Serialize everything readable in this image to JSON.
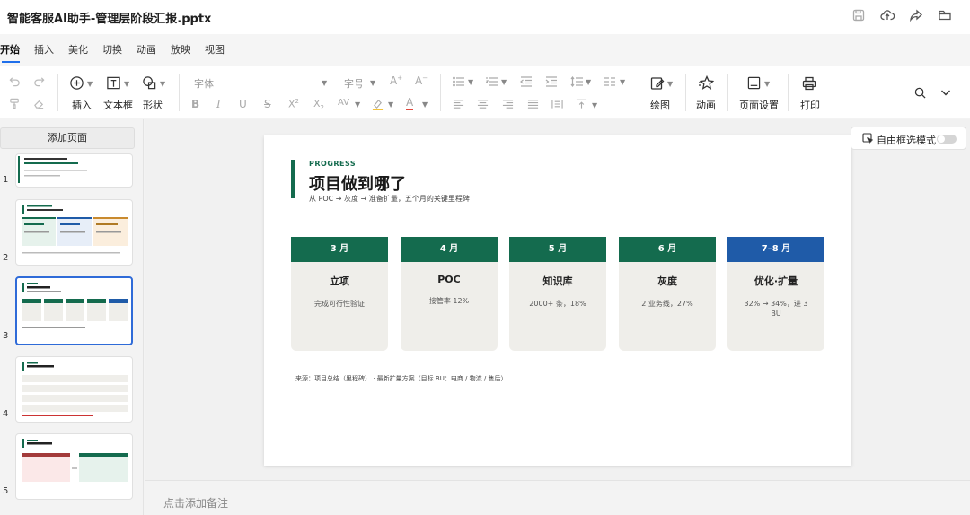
{
  "window": {
    "title": "智能客服AI助手-管理层阶段汇报.pptx"
  },
  "tabs": [
    {
      "label": "开始",
      "active": true
    },
    {
      "label": "插入"
    },
    {
      "label": "美化"
    },
    {
      "label": "切换"
    },
    {
      "label": "动画"
    },
    {
      "label": "放映"
    },
    {
      "label": "视图"
    }
  ],
  "toolbar": {
    "insert_label": "插入",
    "textbox_label": "文本框",
    "shape_label": "形状",
    "font_placeholder": "字体",
    "size_placeholder": "字号",
    "draw_label": "绘图",
    "animate_label": "动画",
    "pagesetup_label": "页面设置",
    "print_label": "打印"
  },
  "left_panel": {
    "add_page_label": "添加页面",
    "thumbnails": [
      {
        "num": "1"
      },
      {
        "num": "2"
      },
      {
        "num": "3",
        "selected": true
      },
      {
        "num": "4"
      },
      {
        "num": "5"
      }
    ]
  },
  "free_select": {
    "label": "自由框选模式"
  },
  "slide": {
    "kicker": "PROGRESS",
    "title": "项目做到哪了",
    "subtitle": "从 POC → 灰度 → 准备扩量，五个月的关键里程碑",
    "accent": "#146b4e",
    "accent2": "#1f5ba8",
    "cards": [
      {
        "month": "3 月",
        "title": "立项",
        "desc": "完成可行性验证"
      },
      {
        "month": "4 月",
        "title": "POC",
        "desc": "接管率 12%"
      },
      {
        "month": "5 月",
        "title": "知识库",
        "desc": "2000+ 条，18%"
      },
      {
        "month": "6 月",
        "title": "灰度",
        "desc": "2 业务线，27%"
      },
      {
        "month": "7–8 月",
        "title": "优化·扩量",
        "desc": "32% → 34%，进 3 BU"
      }
    ],
    "source": "来源：项目总结（里程碑） · 最新扩量方案（目标 BU：电商 / 物流 / 售后）"
  },
  "notes": {
    "placeholder": "点击添加备注"
  }
}
